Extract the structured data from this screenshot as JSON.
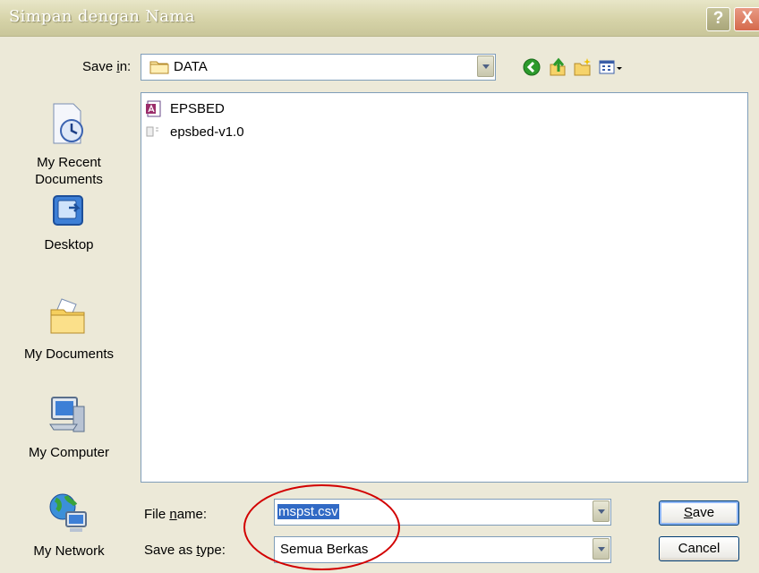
{
  "dialog": {
    "title": "Simpan dengan Nama",
    "help_label": "?",
    "close_label": "X"
  },
  "savein": {
    "label_prefix": "Save ",
    "label_mnemonic": "i",
    "label_suffix": "n:",
    "value": "DATA"
  },
  "toolbar": {
    "icons": [
      "back-icon",
      "up-folder-icon",
      "new-folder-icon",
      "views-menu-icon"
    ]
  },
  "places": [
    {
      "icon": "recent-documents-icon",
      "label_line1": "My Recent",
      "label_line2": "Documents"
    },
    {
      "icon": "desktop-icon",
      "label_line1": "Desktop"
    },
    {
      "icon": "my-documents-icon",
      "label_line1": "My Documents"
    },
    {
      "icon": "my-computer-icon",
      "label_line1": "My Computer"
    },
    {
      "icon": "my-network-icon",
      "label_line1": "My Network"
    }
  ],
  "files": [
    {
      "icon": "access-file-icon",
      "name": "EPSBED"
    },
    {
      "icon": "file-icon",
      "name": "epsbed-v1.0"
    }
  ],
  "filename": {
    "label_prefix": "File ",
    "label_mnemonic": "n",
    "label_suffix": "ame:",
    "value": "mspst.csv"
  },
  "filetype": {
    "label_prefix": "Save as ",
    "label_mnemonic": "t",
    "label_suffix": "ype:",
    "value": "Semua Berkas"
  },
  "buttons": {
    "save_mnemonic": "S",
    "save_rest": "ave",
    "cancel": "Cancel"
  },
  "colors": {
    "annotation": "#d20000",
    "selection": "#316ac5"
  }
}
